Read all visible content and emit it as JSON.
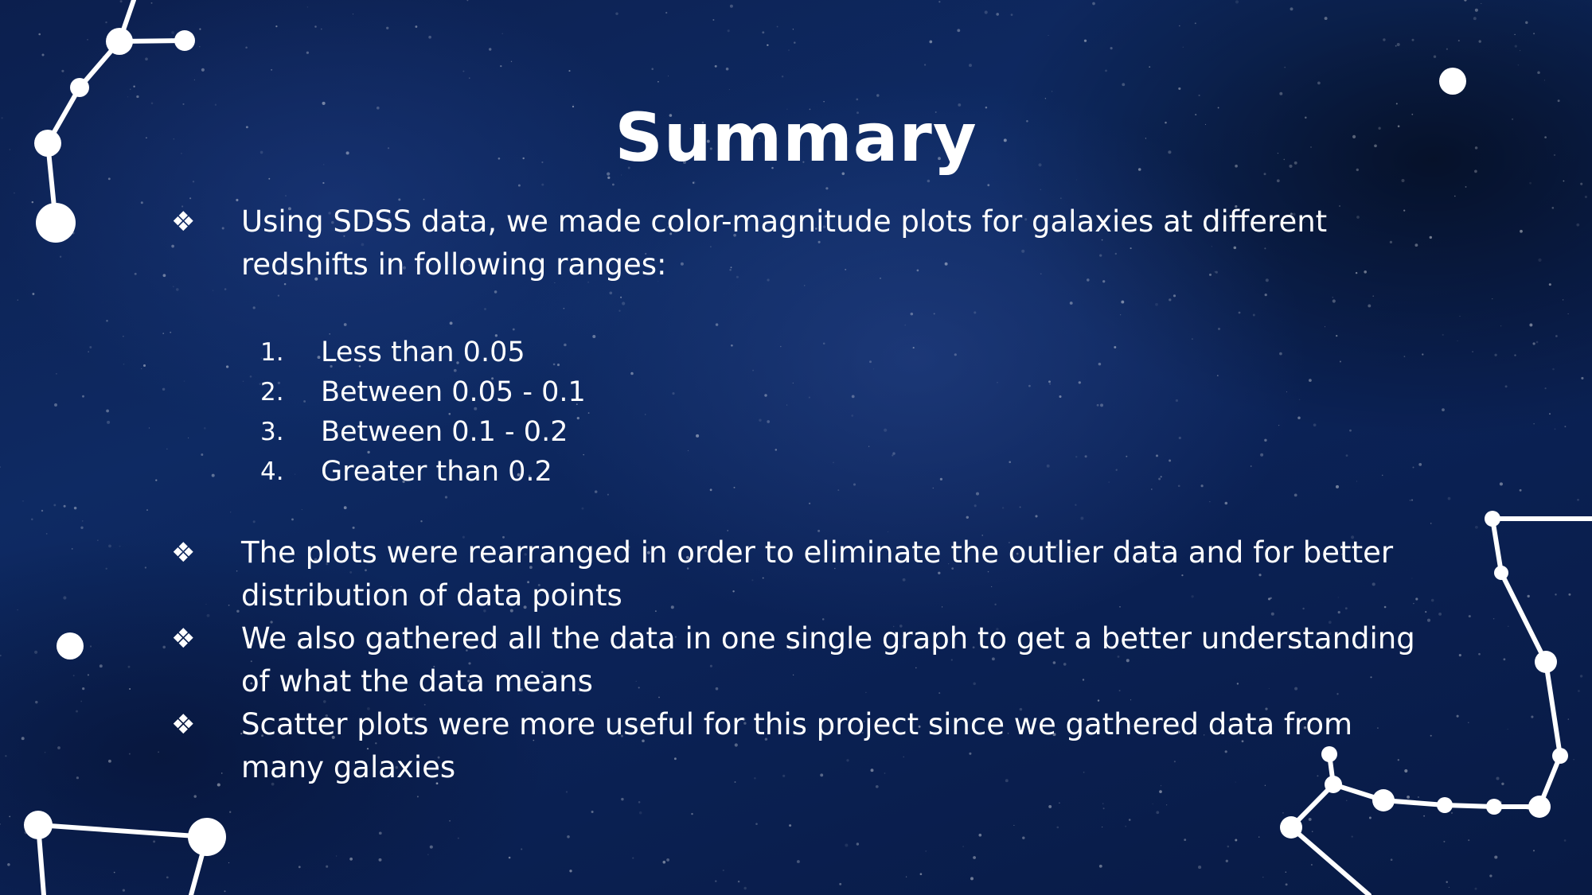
{
  "slide": {
    "title": "Summary",
    "bullet_glyph": "❖",
    "bullets_top": [
      {
        "text": "Using SDSS data, we made color-magnitude plots for galaxies at different redshifts in following ranges:"
      }
    ],
    "ranges": [
      {
        "number": "1.",
        "text": "Less than 0.05"
      },
      {
        "number": "2.",
        "text": "Between 0.05 - 0.1"
      },
      {
        "number": "3.",
        "text": "Between 0.1 - 0.2"
      },
      {
        "number": "4.",
        "text": "Greater than 0.2"
      }
    ],
    "bullets_bottom": [
      {
        "text": "The plots were rearranged in order to eliminate the outlier data and for better distribution of data points"
      },
      {
        "text": "We also gathered all the data in one single graph to get a better understanding of what the data means"
      },
      {
        "text": "Scatter plots were more useful for this project since we gathered data from many galaxies"
      }
    ]
  },
  "colors": {
    "background": "#0c2256",
    "text": "#ffffff",
    "constellation": "#ffffff"
  }
}
